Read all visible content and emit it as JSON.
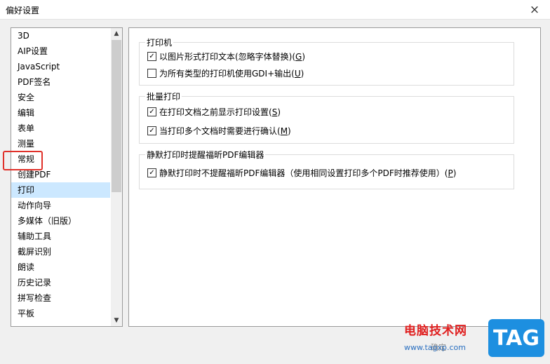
{
  "window": {
    "title": "偏好设置",
    "close_icon": "×"
  },
  "sidebar": {
    "items": [
      {
        "label": "3D"
      },
      {
        "label": "AIP设置"
      },
      {
        "label": "JavaScript"
      },
      {
        "label": "PDF签名"
      },
      {
        "label": "安全"
      },
      {
        "label": "编辑"
      },
      {
        "label": "表单"
      },
      {
        "label": "测量"
      },
      {
        "label": "常规"
      },
      {
        "label": "创建PDF"
      },
      {
        "label": "打印"
      },
      {
        "label": "动作向导"
      },
      {
        "label": "多媒体（旧版）"
      },
      {
        "label": "辅助工具"
      },
      {
        "label": "截屏识别"
      },
      {
        "label": "朗读"
      },
      {
        "label": "历史记录"
      },
      {
        "label": "拼写检查"
      },
      {
        "label": "平板"
      }
    ],
    "selected": "打印",
    "highlighted": "常规",
    "scroll_up_icon": "▲",
    "scroll_down_icon": "▼"
  },
  "printer_group": {
    "legend": "打印机",
    "options": [
      {
        "text": "以图片形式打印文本(忽略字体替换)(",
        "key": "G",
        "suffix": ")",
        "checked": true
      },
      {
        "text": "为所有类型的打印机使用GDI+输出(",
        "key": "U",
        "suffix": ")",
        "checked": false
      }
    ]
  },
  "batch_group": {
    "legend": "批量打印",
    "options": [
      {
        "text": "在打印文档之前显示打印设置(",
        "key": "S",
        "suffix": ")",
        "checked": true
      },
      {
        "text": "当打印多个文档时需要进行确认(",
        "key": "M",
        "suffix": ")",
        "checked": true
      }
    ]
  },
  "silent_group": {
    "legend": "静默打印时提醒福昕PDF编辑器",
    "options": [
      {
        "text": "静默打印时不提醒福昕PDF编辑器（使用相同设置打印多个PDF时推荐使用）(",
        "key": "P",
        "suffix": ")",
        "checked": true
      }
    ]
  },
  "footer": {
    "ok_label": "确定"
  },
  "watermark": {
    "site_name": "电脑技术网",
    "url": "www.tagxp.com",
    "badge": "TAG"
  },
  "colors": {
    "selected_bg": "#cce8ff",
    "highlight_border": "#e0312a",
    "watermark_red": "#e02020",
    "watermark_blue": "#1d8fe0"
  }
}
